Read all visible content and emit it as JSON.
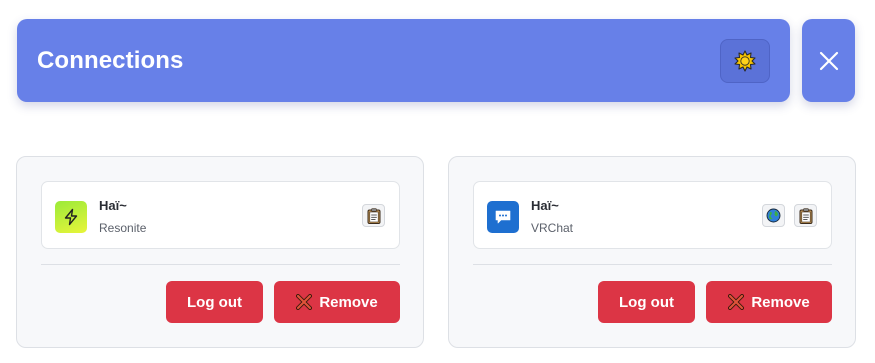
{
  "header": {
    "title": "Connections",
    "settings_icon": "sun-gear-icon",
    "close_icon": "close-icon"
  },
  "colors": {
    "header_bg": "#6780e8",
    "danger": "#dc3545",
    "card_bg": "#f7f8fa"
  },
  "connections": [
    {
      "name": "Haï~",
      "platform": "Resonite",
      "app_icon": "lightning-bolt-icon",
      "actions": [
        "clipboard-icon"
      ],
      "logout_label": "Log out",
      "remove_label": "Remove"
    },
    {
      "name": "Haï~",
      "platform": "VRChat",
      "app_icon": "chat-bubble-icon",
      "actions": [
        "globe-icon",
        "clipboard-icon"
      ],
      "logout_label": "Log out",
      "remove_label": "Remove"
    }
  ]
}
